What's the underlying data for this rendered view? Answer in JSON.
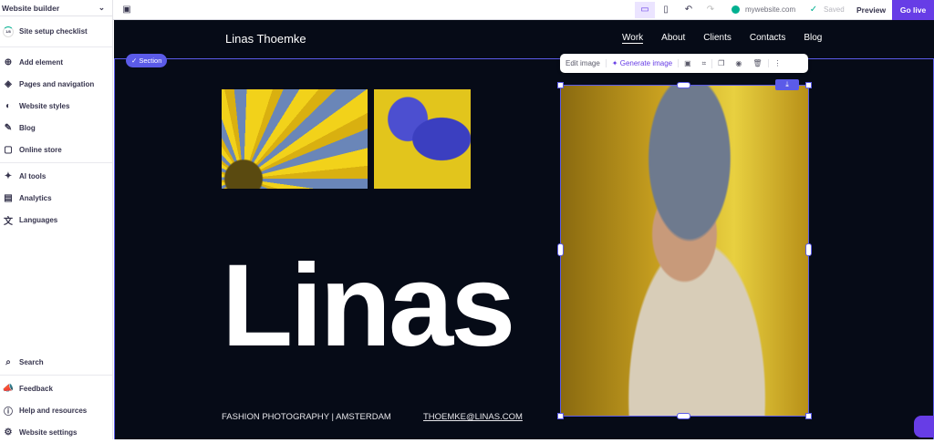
{
  "sidebar": {
    "title": "Website builder",
    "checklist": "Site setup checklist",
    "checklist_progress": "1/8",
    "items": [
      {
        "label": "Add element"
      },
      {
        "label": "Pages and navigation"
      },
      {
        "label": "Website styles"
      },
      {
        "label": "Blog"
      },
      {
        "label": "Online store"
      },
      {
        "label": "AI tools"
      },
      {
        "label": "Analytics"
      },
      {
        "label": "Languages"
      }
    ],
    "bottom": [
      {
        "label": "Search"
      },
      {
        "label": "Feedback"
      },
      {
        "label": "Help and resources"
      },
      {
        "label": "Website settings"
      }
    ]
  },
  "topbar": {
    "domain": "mywebsite.com",
    "saved": "Saved",
    "preview": "Preview",
    "go_live": "Go live",
    "accent": "#673de6"
  },
  "site": {
    "name": "Linas Thoemke",
    "nav": [
      "Work",
      "About",
      "Clients",
      "Contacts",
      "Blog"
    ],
    "hero": "Linas",
    "tagline": "FASHION PHOTOGRAPHY | AMSTERDAM",
    "email": "THOEMKE@LINAS.COM"
  },
  "editor": {
    "section_badge": "Section",
    "edit_image": "Edit image",
    "generate_image": "Generate image"
  }
}
